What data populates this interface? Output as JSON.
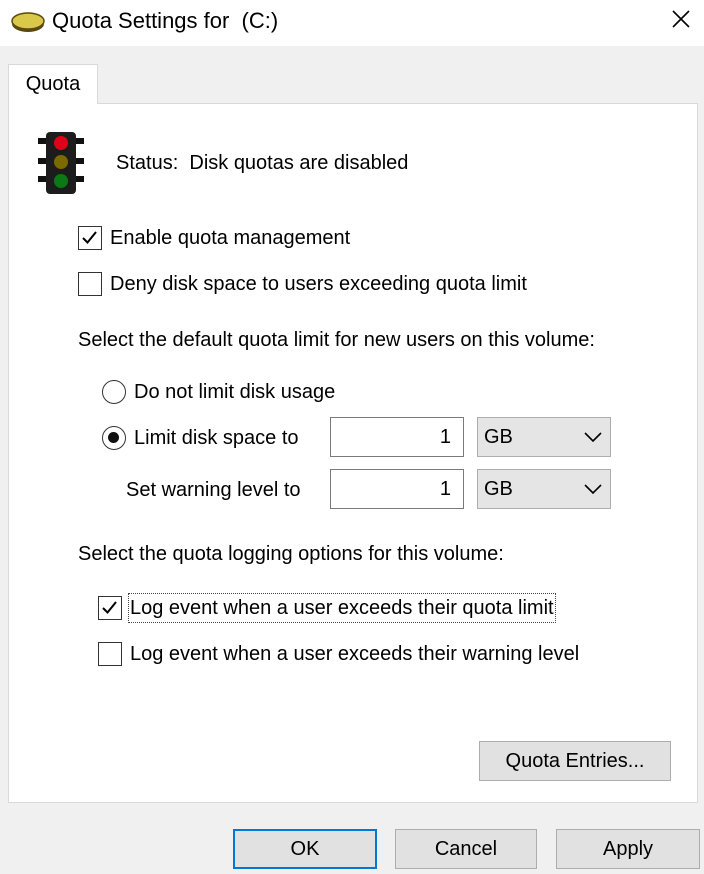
{
  "window": {
    "title": "Quota Settings for  (C:)",
    "icon": "drive-icon"
  },
  "tabs": [
    {
      "label": "Quota",
      "selected": true
    }
  ],
  "status": {
    "text": "Status:  Disk quotas are disabled",
    "icon": "traffic-light-icon"
  },
  "options": {
    "enable_quota": {
      "label": "Enable quota management",
      "checked": true
    },
    "deny_space": {
      "label": "Deny disk space to users exceeding quota limit",
      "checked": false
    }
  },
  "default_limit": {
    "heading": "Select the default quota limit for new users on this volume:",
    "no_limit": {
      "label": "Do not limit disk usage",
      "selected": false
    },
    "limit": {
      "label": "Limit disk space to",
      "selected": true,
      "value": "1",
      "unit": "GB"
    },
    "warning": {
      "label": "Set warning level to",
      "value": "1",
      "unit": "GB"
    }
  },
  "logging": {
    "heading": "Select the quota logging options for this volume:",
    "log_limit": {
      "label": "Log event when a user exceeds their quota limit",
      "checked": true
    },
    "log_warning": {
      "label": "Log event when a user exceeds their warning level",
      "checked": false
    }
  },
  "buttons": {
    "quota_entries": "Quota Entries...",
    "ok": "OK",
    "cancel": "Cancel",
    "apply": "Apply"
  },
  "colors": {
    "focus_border": "#0078d7",
    "red_light": "#e0001a",
    "yellow_light": "#7a6a00",
    "green_light": "#0b7a16"
  }
}
